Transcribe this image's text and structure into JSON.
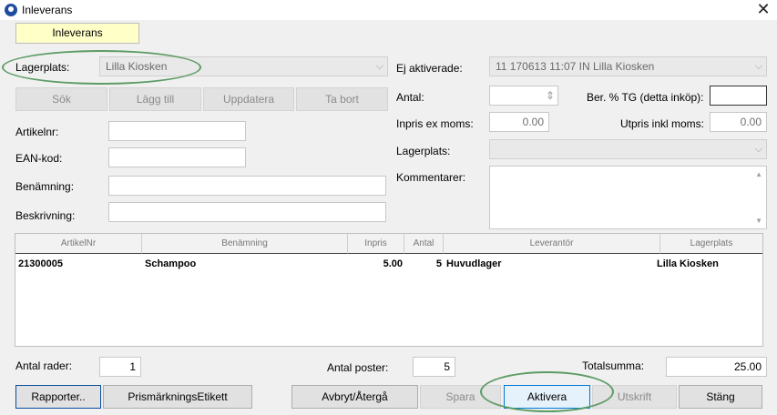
{
  "window": {
    "title": "Inleverans",
    "close_glyph": "✕"
  },
  "tab": {
    "label": "Inleverans"
  },
  "left": {
    "lagerplats_label": "Lagerplats:",
    "lagerplats_value": "Lilla Kiosken",
    "buttons": {
      "sok": "Sök",
      "lagg_till": "Lägg till",
      "uppdatera": "Uppdatera",
      "ta_bort": "Ta bort"
    },
    "artikelnr_label": "Artikelnr:",
    "ean_label": "EAN-kod:",
    "benamning_label": "Benämning:",
    "beskrivning_label": "Beskrivning:"
  },
  "right": {
    "ej_aktiverade_label": "Ej aktiverade:",
    "ej_aktiverade_value": "11 170613 11:07 IN Lilla Kiosken",
    "antal_label": "Antal:",
    "ber_tg_label": "Ber. % TG (detta inköp):",
    "inpris_label": "Inpris ex moms:",
    "inpris_value": "0.00",
    "utpris_label": "Utpris inkl moms:",
    "utpris_value": "0.00",
    "lagerplats_label": "Lagerplats:",
    "kommentarer_label": "Kommentarer:"
  },
  "grid": {
    "columns": [
      "ArtikelNr",
      "Benämning",
      "Inpris",
      "Antal",
      "Leverantör",
      "Lagerplats"
    ],
    "rows": [
      {
        "artikelnr": "21300005",
        "benamning": "Schampoo",
        "inpris": "5.00",
        "antal": "5",
        "leverantor": "Huvudlager",
        "lagerplats": "Lilla Kiosken"
      }
    ]
  },
  "footer": {
    "antal_rader_label": "Antal rader:",
    "antal_rader_value": "1",
    "antal_poster_label": "Antal poster:",
    "antal_poster_value": "5",
    "totalsumma_label": "Totalsumma:",
    "totalsumma_value": "25.00"
  },
  "bottom_buttons": {
    "rapporter": "Rapporter..",
    "prismarkning": "PrismärkningsEtikett",
    "avbryt": "Avbryt/Återgå",
    "spara": "Spara",
    "aktivera": "Aktivera",
    "utskrift": "Utskrift",
    "stang": "Stäng"
  },
  "colors": {
    "highlight_ellipse": "#5d9c65",
    "tab_background": "#ffffc8",
    "aktivera_border": "#0078d7"
  },
  "icons": {
    "app": "app-logo-icon",
    "close": "close-icon",
    "chevron": "chevron-down-icon",
    "spinner": "updown-spinner-icon"
  }
}
